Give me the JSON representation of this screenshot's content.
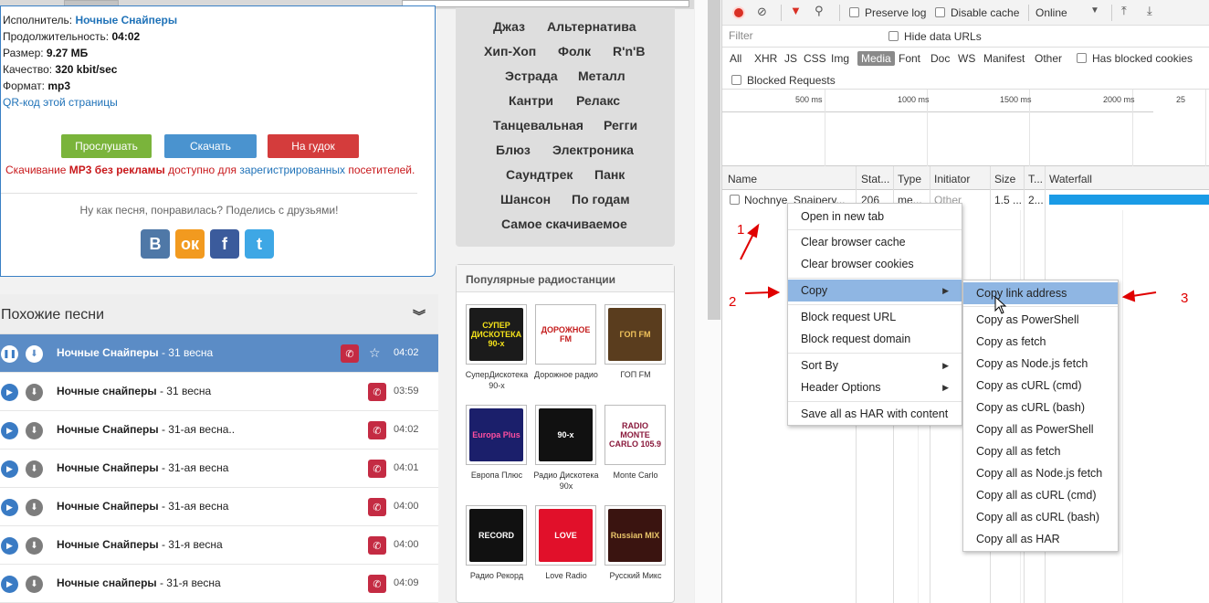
{
  "song_info": {
    "artist_label": "Исполнитель:",
    "artist": "Ночные Снайперы",
    "duration_label": "Продолжительность:",
    "duration": "04:02",
    "size_label": "Размер:",
    "size": "9.27 МБ",
    "quality_label": "Качество:",
    "quality": "320 kbit/sec",
    "format_label": "Формат:",
    "format": "mp3",
    "qr_link": "QR-код этой страницы"
  },
  "buttons": {
    "listen": "Прослушать",
    "download": "Скачать",
    "ringtone": "На гудок"
  },
  "notice": {
    "part1": "Скачивание ",
    "bold": "MP3 без рекламы",
    "part2": " доступно для ",
    "link": "зарегистрированных",
    "part3": " посетителей."
  },
  "share": {
    "text": "Ну как песня, понравилась? Поделись с друзьями!",
    "networks": [
      {
        "glyph": "В",
        "color": "#4f78a7",
        "icon": "vk-icon"
      },
      {
        "glyph": "ок",
        "color": "#f29a1f",
        "icon": "odnoklassniki-icon"
      },
      {
        "glyph": "f",
        "color": "#3b5b9c",
        "icon": "facebook-icon"
      },
      {
        "glyph": "t",
        "color": "#3ea7e5",
        "icon": "twitter-icon"
      }
    ]
  },
  "similar": {
    "title": "Похожие песни",
    "songs": [
      {
        "artist": "Ночные Снайперы",
        "title": " - 31 весна",
        "duration": "04:02",
        "active": true
      },
      {
        "artist": "Ночные снайперы",
        "title": " - 31 весна",
        "duration": "03:59",
        "active": false
      },
      {
        "artist": "Ночные Снайперы",
        "title": " - 31-ая весна..",
        "duration": "04:02",
        "active": false
      },
      {
        "artist": "Ночные Снайперы",
        "title": " - 31-ая весна",
        "duration": "04:01",
        "active": false
      },
      {
        "artist": "Ночные Снайперы",
        "title": " - 31-ая весна",
        "duration": "04:00",
        "active": false
      },
      {
        "artist": "Ночные Снайперы",
        "title": " - 31-я весна",
        "duration": "04:00",
        "active": false
      },
      {
        "artist": "Ночные снайперы",
        "title": " - 31-я весна",
        "duration": "04:09",
        "active": false
      }
    ]
  },
  "genres": [
    [
      "Джаз",
      "Альтернатива"
    ],
    [
      "Хип-Хоп",
      "Фолк",
      "R'n'B"
    ],
    [
      "Эстрада",
      "Металл"
    ],
    [
      "Кантри",
      "Релакс"
    ],
    [
      "Танцевальная",
      "Регги"
    ],
    [
      "Блюз",
      "Электроника"
    ],
    [
      "Саундтрек",
      "Панк"
    ],
    [
      "Шансон",
      "По годам"
    ],
    [
      "Самое скачиваемое"
    ]
  ],
  "radio": {
    "title": "Популярные радиостанции",
    "stations": [
      {
        "name": "СуперДискотека 90-х",
        "logo": "СУПЕР ДИСКОТЕКА 90-х",
        "bg": "#1b1b1b",
        "fg": "#f4e21a"
      },
      {
        "name": "Дорожное радио",
        "logo": "ДОРОЖНОЕ FM",
        "bg": "#ffffff",
        "fg": "#c41d1d"
      },
      {
        "name": "ГОП FM",
        "logo": "ГОП FM",
        "bg": "#5a3d1e",
        "fg": "#f0c35b"
      },
      {
        "name": "Европа Плюс",
        "logo": "Europa Plus",
        "bg": "#1b1f6b",
        "fg": "#ff4fa0"
      },
      {
        "name": "Радио Дискотека 90х",
        "logo": "90-х",
        "bg": "#111111",
        "fg": "#ffffff"
      },
      {
        "name": "Monte Carlo",
        "logo": "RADIO MONTE CARLO 105.9",
        "bg": "#ffffff",
        "fg": "#8a1a3c"
      },
      {
        "name": "Радио Рекорд",
        "logo": "RECORD",
        "bg": "#111111",
        "fg": "#ffffff"
      },
      {
        "name": "Love Radio",
        "logo": "LOVE",
        "bg": "#e1102a",
        "fg": "#ffffff"
      },
      {
        "name": "Русский Микс",
        "logo": "Russian MIX",
        "bg": "#3a1410",
        "fg": "#e9c56a"
      }
    ]
  },
  "devtools": {
    "toolbar": {
      "preserve_log": "Preserve log",
      "disable_cache": "Disable cache",
      "throttle": "Online"
    },
    "filter_placeholder": "Filter",
    "hide_data_urls": "Hide data URLs",
    "types": [
      "All",
      "XHR",
      "JS",
      "CSS",
      "Img",
      "Media",
      "Font",
      "Doc",
      "WS",
      "Manifest",
      "Other"
    ],
    "selected_type": "Media",
    "has_blocked_cookies": "Has blocked cookies",
    "blocked_requests": "Blocked Requests",
    "overview_ticks": [
      "500 ms",
      "1000 ms",
      "1500 ms",
      "2000 ms",
      "25"
    ],
    "columns": [
      "Name",
      "Stat...",
      "Type",
      "Initiator",
      "Size",
      "T...",
      "Waterfall"
    ],
    "request": {
      "name": "Nochnye_Snajpery...",
      "status": "206",
      "type": "me...",
      "initiator": "Other",
      "size": "1.5 ...",
      "time": "2..."
    }
  },
  "context_menu": {
    "items": [
      {
        "label": "Open in new tab"
      },
      {
        "label": "Clear browser cache"
      },
      {
        "label": "Clear browser cookies"
      },
      {
        "label": "Copy",
        "submenu": true,
        "highlight": true
      },
      {
        "label": "Block request URL"
      },
      {
        "label": "Block request domain"
      },
      {
        "label": "Sort By",
        "submenu": true
      },
      {
        "label": "Header Options",
        "submenu": true
      },
      {
        "label": "Save all as HAR with content"
      }
    ]
  },
  "copy_submenu": {
    "items": [
      "Copy link address",
      "Copy as PowerShell",
      "Copy as fetch",
      "Copy as Node.js fetch",
      "Copy as cURL (cmd)",
      "Copy as cURL (bash)",
      "Copy all as PowerShell",
      "Copy all as fetch",
      "Copy all as Node.js fetch",
      "Copy all as cURL (cmd)",
      "Copy all as cURL (bash)",
      "Copy all as HAR"
    ],
    "highlighted": "Copy link address"
  },
  "annotations": [
    "1",
    "2",
    "3"
  ],
  "colors": {
    "accent": "#3a80c5",
    "annotation": "#e00000",
    "menu_highlight": "#8fb6e3"
  }
}
